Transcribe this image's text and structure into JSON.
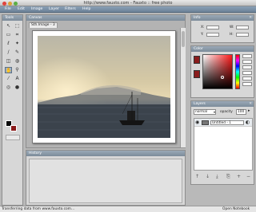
{
  "window": {
    "title": "http://www.fauxto.com - Fauxto :: free photo"
  },
  "menu": [
    "File",
    "Edit",
    "Image",
    "Layer",
    "Filters",
    "Help"
  ],
  "tools_panel": {
    "title": "Tools"
  },
  "tools": [
    {
      "name": "move-icon",
      "glyph": "↖"
    },
    {
      "name": "marquee-icon",
      "glyph": "⬚"
    },
    {
      "name": "rect-select-icon",
      "glyph": "▭"
    },
    {
      "name": "crop-icon",
      "glyph": "⌗"
    },
    {
      "name": "lasso-icon",
      "glyph": "ℓ"
    },
    {
      "name": "wand-icon",
      "glyph": "✦"
    },
    {
      "name": "brush-icon",
      "glyph": "/"
    },
    {
      "name": "pencil-icon",
      "glyph": "✎"
    },
    {
      "name": "eraser-icon",
      "glyph": "◫"
    },
    {
      "name": "fill-icon",
      "glyph": "◍"
    },
    {
      "name": "hand-icon",
      "glyph": "✋"
    },
    {
      "name": "zoom-icon",
      "glyph": "⚲"
    },
    {
      "name": "eyedropper-icon",
      "glyph": "⁄"
    },
    {
      "name": "text-icon",
      "glyph": "A"
    },
    {
      "name": "clone-icon",
      "glyph": "◎"
    },
    {
      "name": "shape-icon",
      "glyph": "●"
    }
  ],
  "canvas_panel": {
    "title": "Canvas",
    "tab": "Sth.Image - 3"
  },
  "history_panel": {
    "title": "History"
  },
  "info_panel": {
    "title": "Info",
    "x_label": "X:",
    "y_label": "Y:",
    "w_label": "W:",
    "h_label": "H:"
  },
  "color_panel": {
    "title": "Color"
  },
  "layers_panel": {
    "title": "Layers",
    "blend_mode": "normal",
    "opacity_label": "opacity",
    "opacity_value": "100",
    "layer_name": "Untitled - 1"
  },
  "status": {
    "left": "Transferring data from www.fauxto.com...",
    "right": "Open Notebook"
  },
  "colors": {
    "foreground": "#0a0a0a",
    "background": "#8a1c1c",
    "accent": "#7c8b9a"
  }
}
